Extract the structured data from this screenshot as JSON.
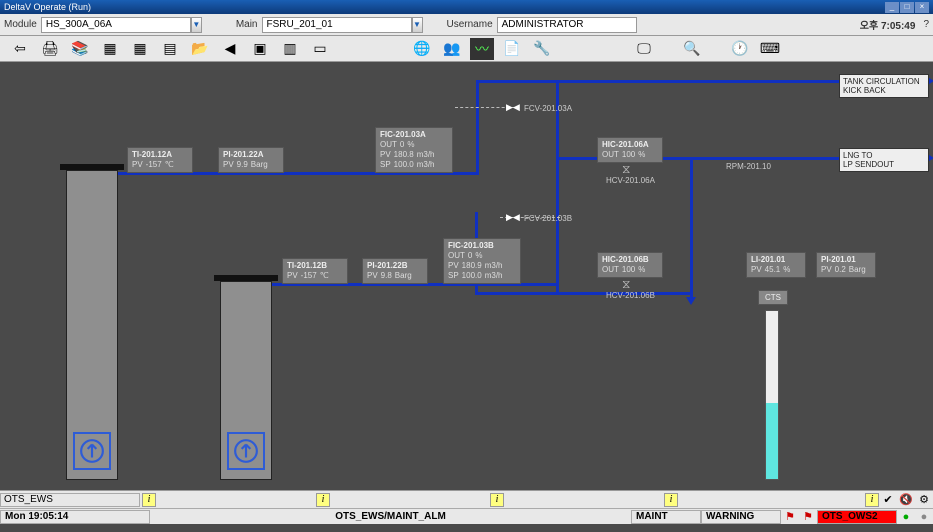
{
  "titlebar": {
    "title": "DeltaV Operate (Run)"
  },
  "infobar": {
    "module_lbl": "Module",
    "module_val": "HS_300A_06A",
    "main_lbl": "Main",
    "main_val": "FSRU_201_01",
    "user_lbl": "Username",
    "user_val": "ADMINISTRATOR",
    "time": "오후 7:05:49"
  },
  "boxes": {
    "tank_circ": "TANK CIRCULATION\nKICK BACK",
    "lng_to": "LNG TO\nLP SENDOUT"
  },
  "tags": {
    "ti12a": {
      "t": "TI-201.12A",
      "l1": "PV",
      "v1": "-157",
      "u1": "℃"
    },
    "pi22a": {
      "t": "PI-201.22A",
      "l1": "PV",
      "v1": "9.9",
      "u1": "Barg"
    },
    "fic03a": {
      "t": "FIC-201.03A",
      "r1": "OUT",
      "rv1": "0",
      "ru1": "%",
      "r2": "PV",
      "rv2": "180.8",
      "ru2": "m3/h",
      "r3": "SP",
      "rv3": "100.0",
      "ru3": "m3/h"
    },
    "hic06a": {
      "t": "HIC-201.06A",
      "l1": "OUT",
      "v1": "100",
      "u1": "%"
    },
    "ti12b": {
      "t": "TI-201.12B",
      "l1": "PV",
      "v1": "-157",
      "u1": "℃"
    },
    "pi22b": {
      "t": "PI-201.22B",
      "l1": "PV",
      "v1": "9.8",
      "u1": "Barg"
    },
    "fic03b": {
      "t": "FIC-201.03B",
      "r1": "OUT",
      "rv1": "0",
      "ru1": "%",
      "r2": "PV",
      "rv2": "180.9",
      "ru2": "m3/h",
      "r3": "SP",
      "rv3": "100.0",
      "ru3": "m3/h"
    },
    "hic06b": {
      "t": "HIC-201.06B",
      "l1": "OUT",
      "v1": "100",
      "u1": "%"
    },
    "li01": {
      "t": "LI-201.01",
      "l1": "PV",
      "v1": "45.1",
      "u1": "%"
    },
    "pi01": {
      "t": "PI-201.01",
      "l1": "PV",
      "v1": "0.2",
      "u1": "Barg"
    }
  },
  "labels": {
    "fcv03a": "FCV-201.03A",
    "fcv03b": "FCV-201.03B",
    "hcv06a": "HCV-201.06A",
    "hcv06b": "HCV-201.06B",
    "rpm": "RPM-201.10",
    "cts": "CTS"
  },
  "status1": {
    "ots_ews": "OTS_EWS"
  },
  "status2": {
    "time": "Mon 19:05:14",
    "path": "OTS_EWS/MAINT_ALM",
    "maint": "MAINT",
    "warning": "WARNING",
    "ows": "OTS_OWS2"
  }
}
